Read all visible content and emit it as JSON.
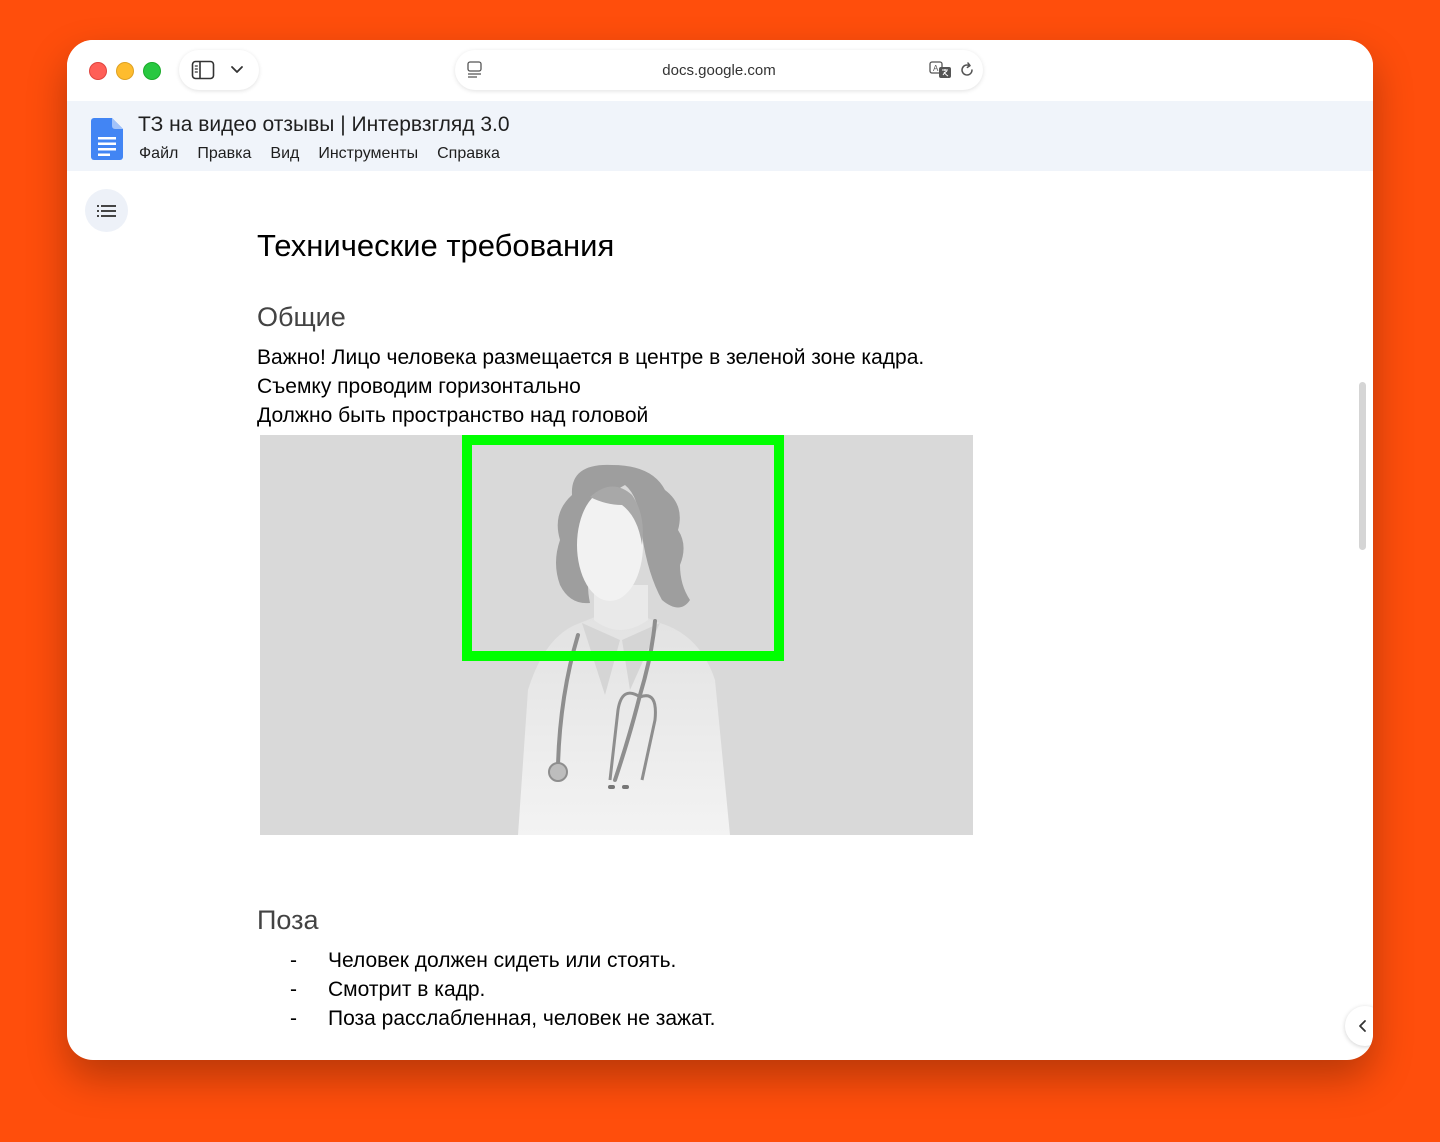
{
  "browser": {
    "url": "docs.google.com"
  },
  "doc": {
    "title": "ТЗ на видео отзывы | Интервзгляд 3.0",
    "menu": [
      "Файл",
      "Правка",
      "Вид",
      "Инструменты",
      "Справка"
    ]
  },
  "content": {
    "heading": "Технические требования",
    "section1": {
      "title": "Общие",
      "lines": [
        "Важно! Лицо человека размещается в центре в зеленой зоне кадра.",
        "Съемку проводим горизонтально",
        "Должно быть пространство над головой"
      ]
    },
    "section2": {
      "title": "Поза",
      "bullet_marker": "-",
      "bullets": [
        "Человек должен сидеть или стоять.",
        "Смотрит в кадр.",
        "Поза расслабленная, человек не зажат."
      ]
    }
  },
  "colors": {
    "background": "#ff4e0c",
    "frame": "#00ff00",
    "docs_blue": "#4285f4"
  }
}
